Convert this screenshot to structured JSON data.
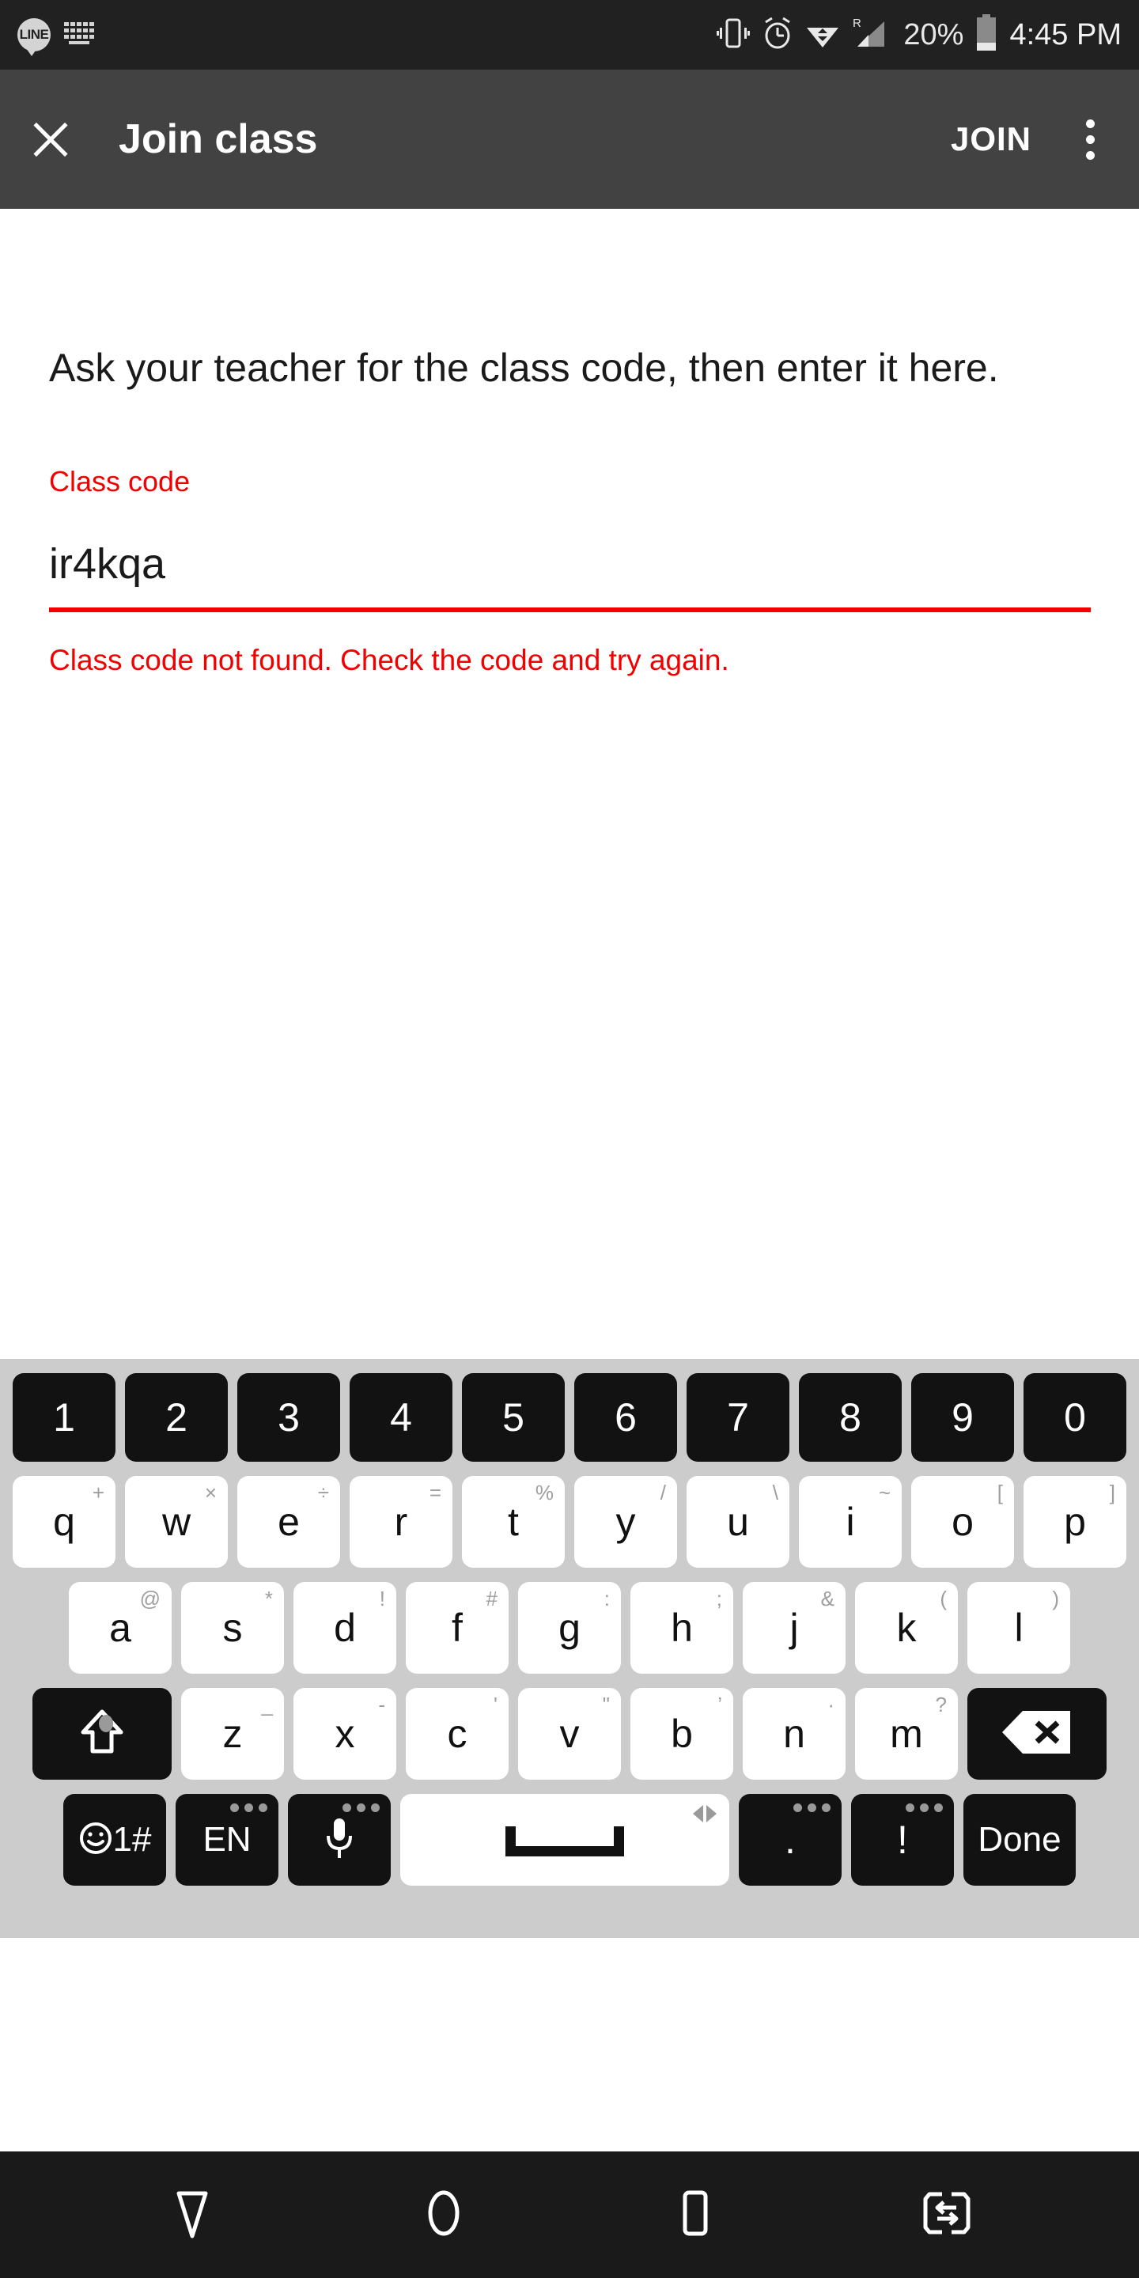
{
  "status_bar": {
    "left_icons": [
      "line-app-icon",
      "keyboard-icon"
    ],
    "app_badge_label": "LINE",
    "right_icons": [
      "vibrate-icon",
      "alarm-clock-icon",
      "wifi-icon",
      "roaming-signal-icon",
      "battery-icon"
    ],
    "roaming_label": "R",
    "battery_percent": "20%",
    "time": "4:45 PM",
    "background": "#212121"
  },
  "app_bar": {
    "close_icon": "close-icon",
    "title": "Join class",
    "join_label": "JOIN",
    "overflow_icon": "overflow-menu-icon",
    "background": "#424242"
  },
  "content": {
    "instruction": "Ask your teacher for the class code, then enter it here.",
    "field_label": "Class code",
    "field_value": "ir4kqa",
    "field_placeholder": "Class code",
    "error_message": "Class code not found. Check the code and try again.",
    "error_color": "#f20000"
  },
  "keyboard": {
    "background": "#cccccc",
    "row_numbers": [
      {
        "main": "1"
      },
      {
        "main": "2"
      },
      {
        "main": "3"
      },
      {
        "main": "4"
      },
      {
        "main": "5"
      },
      {
        "main": "6"
      },
      {
        "main": "7"
      },
      {
        "main": "8"
      },
      {
        "main": "9"
      },
      {
        "main": "0"
      }
    ],
    "row_top": [
      {
        "main": "q",
        "sup": "+"
      },
      {
        "main": "w",
        "sup": "×"
      },
      {
        "main": "e",
        "sup": "÷"
      },
      {
        "main": "r",
        "sup": "="
      },
      {
        "main": "t",
        "sup": "%"
      },
      {
        "main": "y",
        "sup": "/"
      },
      {
        "main": "u",
        "sup": "\\"
      },
      {
        "main": "i",
        "sup": "~"
      },
      {
        "main": "o",
        "sup": "["
      },
      {
        "main": "p",
        "sup": "]"
      }
    ],
    "row_home": [
      {
        "main": "a",
        "sup": "@"
      },
      {
        "main": "s",
        "sup": "*"
      },
      {
        "main": "d",
        "sup": "!"
      },
      {
        "main": "f",
        "sup": "#"
      },
      {
        "main": "g",
        "sup": ":"
      },
      {
        "main": "h",
        "sup": ";"
      },
      {
        "main": "j",
        "sup": "&"
      },
      {
        "main": "k",
        "sup": "("
      },
      {
        "main": "l",
        "sup": ")"
      }
    ],
    "row_bottom": [
      {
        "main": "z",
        "sup": "_"
      },
      {
        "main": "x",
        "sup": "-"
      },
      {
        "main": "c",
        "sup": "'"
      },
      {
        "main": "v",
        "sup": "\""
      },
      {
        "main": "b",
        "sup": "’"
      },
      {
        "main": "n",
        "sup": "·"
      },
      {
        "main": "m",
        "sup": "?"
      }
    ],
    "shift_key": "shift-key",
    "backspace_key": "backspace-key",
    "fn_row": {
      "symbols_label": "1#",
      "symbols_icon": "emoji-icon",
      "language_label": "EN",
      "mic_icon": "microphone-icon",
      "space_icon": "space-bar-icon",
      "period_label": ".",
      "exclaim_label": "!",
      "done_label": "Done"
    }
  },
  "nav_bar": {
    "background": "#1a1a1a",
    "buttons": [
      "back-icon",
      "home-icon",
      "recents-icon",
      "switch-app-icon"
    ]
  }
}
